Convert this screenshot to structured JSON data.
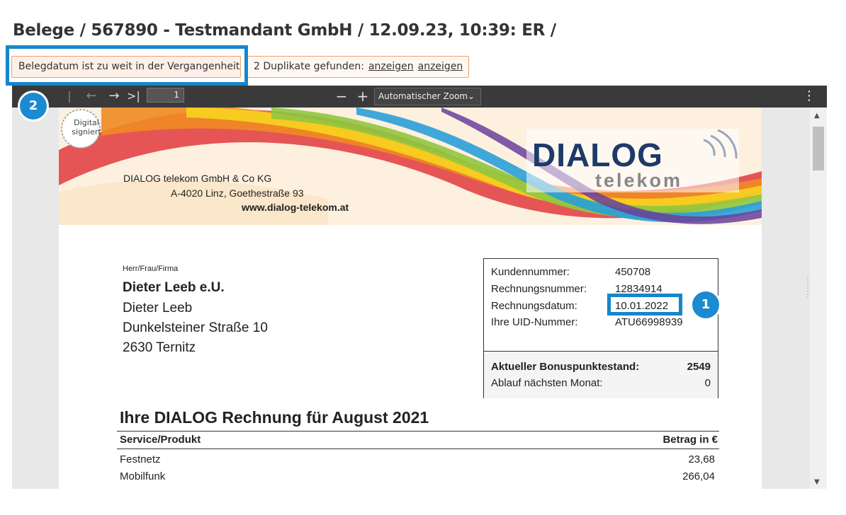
{
  "breadcrumb": "Belege / 567890 - Testmandant GmbH / 12.09.23, 10:39: ER /",
  "warnings": {
    "date_warning": "Belegdatum ist zu weit in der Vergangenheit",
    "duplicates_label": "2 Duplikate gefunden:",
    "duplicate_links": [
      "anzeigen",
      "anzeigen"
    ]
  },
  "badges": {
    "one": "1",
    "two": "2"
  },
  "viewer": {
    "page_number": "1",
    "zoom_label": "Automatischer Zoom",
    "icons": [
      "first-page-icon",
      "prev-page-icon",
      "next-page-icon",
      "last-page-icon",
      "zoom-out-icon",
      "zoom-in-icon",
      "more-menu-icon"
    ]
  },
  "document": {
    "stamp": [
      "Digital",
      "signiert"
    ],
    "sender": {
      "line1": "DIALOG telekom GmbH & Co KG",
      "line2": "A-4020 Linz, Goethestraße 93",
      "web": "www.dialog-telekom.at"
    },
    "logo": {
      "main": "DIALOG",
      "sub": "telekom"
    },
    "salutation": "Herr/Frau/Firma",
    "customer": {
      "company": "Dieter Leeb e.U.",
      "name": "Dieter Leeb",
      "street": "Dunkelsteiner Straße  10",
      "city": "2630 Ternitz"
    },
    "info": [
      {
        "label": "Kundennummer:",
        "value": "450708"
      },
      {
        "label": "Rechnungsnummer:",
        "value": "12834914"
      },
      {
        "label": "Rechnungsdatum:",
        "value": "10.01.2022"
      },
      {
        "label": "Ihre UID-Nummer:",
        "value": "ATU66998939"
      }
    ],
    "bonus": {
      "label": "Aktueller Bonuspunktestand:",
      "value": "2549",
      "expiry_label": "Ablauf nächsten Monat:",
      "expiry_value": "0"
    },
    "invoice_title": "Ihre DIALOG Rechnung für August 2021",
    "table": {
      "headers": [
        "Service/Produkt",
        "Betrag in €"
      ],
      "rows": [
        {
          "item": "Festnetz",
          "amount": "23,68"
        },
        {
          "item": "Mobilfunk",
          "amount": "266,04"
        }
      ]
    }
  },
  "colors": {
    "highlight": "#1786c9",
    "badge": "#1c8ad0",
    "warning_border": "#f0a06a",
    "toolbar": "#3a3a3a",
    "logo": "#1d3a6a"
  }
}
